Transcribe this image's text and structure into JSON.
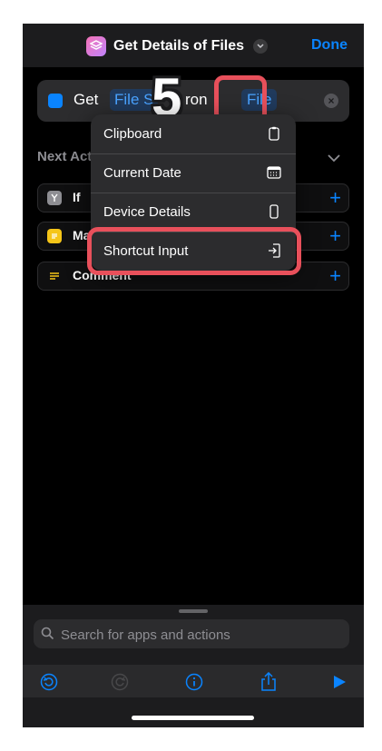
{
  "nav": {
    "title": "Get Details of Files",
    "done_label": "Done"
  },
  "action": {
    "get": "Get",
    "file_size": "File S",
    "from": "ron",
    "file": "File"
  },
  "step": {
    "number": "5"
  },
  "next_actions": {
    "header": "Next Act",
    "items": [
      {
        "label": "If",
        "icon": "branch-icon",
        "color": "#8e8e93"
      },
      {
        "label": "Ma",
        "icon": "notes-icon",
        "color": "#f5c518"
      },
      {
        "label": "Comment",
        "icon": "comment-icon",
        "color": "#f5c518"
      }
    ]
  },
  "menu": {
    "items": [
      {
        "label": "Clipboard",
        "icon": "clipboard-icon"
      },
      {
        "label": "Current Date",
        "icon": "calendar-icon"
      },
      {
        "label": "Device Details",
        "icon": "phone-icon"
      },
      {
        "label": "Shortcut Input",
        "icon": "input-icon"
      }
    ]
  },
  "search": {
    "placeholder": "Search for apps and actions"
  },
  "toolbar": [
    "undo-icon",
    "redo-icon",
    "info-icon",
    "share-icon",
    "play-icon"
  ],
  "colors": {
    "accent": "#0a84ff",
    "highlight": "#e8505b",
    "background": "#000000"
  }
}
